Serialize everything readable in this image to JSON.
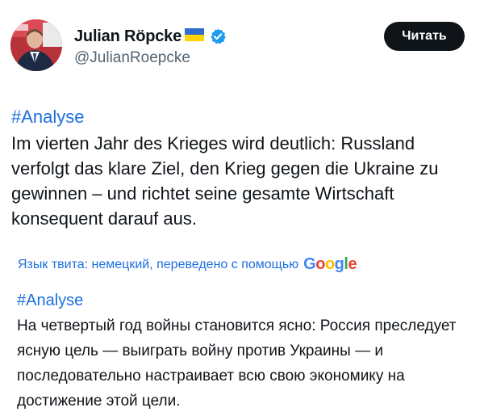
{
  "author": {
    "name": "Julian Röpcke",
    "handle": "@JulianRoepcke",
    "flag": "ukraine-flag",
    "verified": "verified-badge-icon"
  },
  "follow_button": {
    "label": "Читать"
  },
  "tweet": {
    "hashtag": "#Analyse",
    "text": "Im vierten Jahr des Krieges wird deutlich: Russland verfolgt das klare Ziel, den Krieg gegen die Ukraine zu gewinnen – und richtet seine gesamte Wirtschaft konsequent darauf aus."
  },
  "translation": {
    "note": "Язык твита: немецкий, переведено с помощью",
    "provider": "Google",
    "hashtag": "#Analyse",
    "text": "На четвертый год войны становится ясно: Россия преследует ясную цель — выиграть войну против Украины — и последовательно настраивает всю свою экономику на достижение этой цели."
  },
  "colors": {
    "link": "#1d6fe0",
    "text": "#0f1419",
    "secondary": "#536471",
    "button_bg": "#0f1419",
    "verified": "#1d9bf0"
  }
}
